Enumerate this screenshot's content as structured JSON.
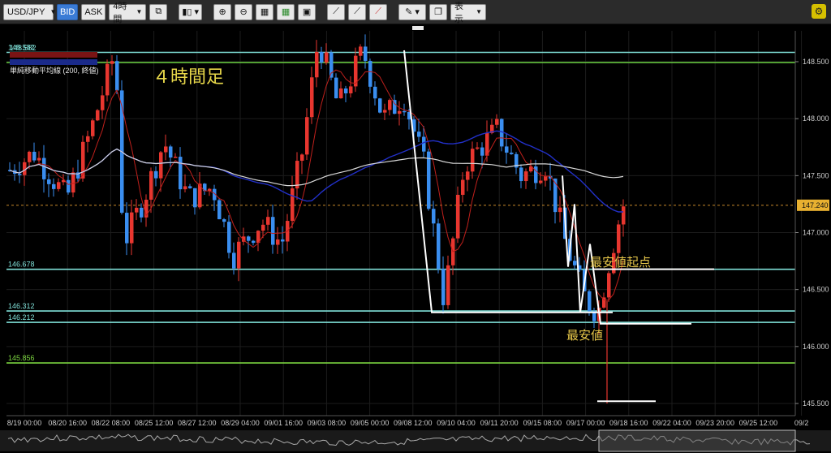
{
  "toolbar": {
    "symbol": "USD/JPY",
    "bid_label": "BID",
    "ask_label": "ASK",
    "timeframe": "4時間",
    "display_label": "表示"
  },
  "legend": {
    "price_tag": "148.582",
    "ma_line3": "単純移動平均線 (200, 終値)"
  },
  "annotations": {
    "timeframe_title": "４時間足",
    "lowest_start": "最安値起点",
    "lowest": "最安値"
  },
  "chart_data": {
    "type": "candlestick",
    "y_axis": {
      "min": 145.4,
      "max": 148.9,
      "ticks": [
        "148.500",
        "148.000",
        "147.500",
        "147.000",
        "146.500",
        "146.000",
        "145.500"
      ]
    },
    "x_ticks": [
      "8/19 00:00",
      "08/20 16:00",
      "08/22 08:00",
      "08/25 12:00",
      "08/27 12:00",
      "08/29 04:00",
      "09/01 16:00",
      "09/03 08:00",
      "09/05 00:00",
      "09/08 12:00",
      "09/10 04:00",
      "09/11 20:00",
      "09/15 08:00",
      "09/17 00:00",
      "09/18 16:00",
      "09/22 04:00",
      "09/23 20:00",
      "09/25 12:00",
      "09/2"
    ],
    "current_price": {
      "label": "147.240",
      "value": 147.24
    },
    "horizontal_lines": [
      {
        "label": "148.582",
        "value": 148.582,
        "color": "#7fe0d8"
      },
      {
        "label": "146.678",
        "value": 146.678,
        "color": "#7fe0d8"
      },
      {
        "label": "146.312",
        "value": 146.312,
        "color": "#7fe0d8"
      },
      {
        "label": "146.212",
        "value": 146.212,
        "color": "#7fe0d8"
      },
      {
        "label": "145.856",
        "value": 145.856,
        "color": "#7cd640"
      }
    ],
    "colors": {
      "up": "#e8362f",
      "down": "#3a8ef0",
      "ma_fast": "#c0201c",
      "ma_mid": "#2230c8",
      "ma_slow": "#d8d8d8",
      "zigzag": "#ffffff",
      "label": "#e8c84a"
    }
  }
}
